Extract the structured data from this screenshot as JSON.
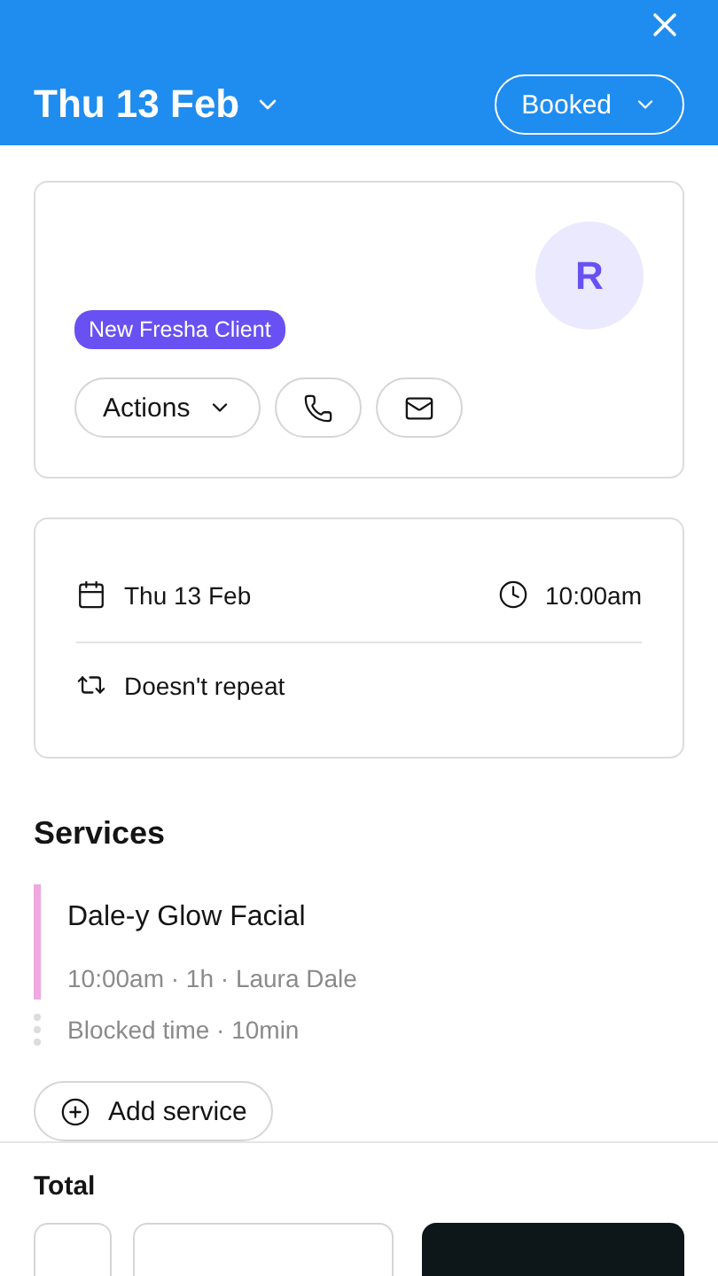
{
  "header": {
    "date": "Thu 13 Feb",
    "status": "Booked"
  },
  "client": {
    "avatar_initial": "R",
    "badge": "New Fresha Client",
    "actions_label": "Actions"
  },
  "schedule": {
    "date": "Thu 13 Feb",
    "time": "10:00am",
    "repeat": "Doesn't repeat"
  },
  "services": {
    "title": "Services",
    "items": [
      {
        "name": "Dale-y Glow Facial",
        "details": "10:00am · 1h · Laura Dale",
        "color": "#f0a8e0",
        "blocked": "Blocked time · 10min"
      }
    ],
    "add_label": "Add service"
  },
  "footer": {
    "total_label": "Total"
  }
}
